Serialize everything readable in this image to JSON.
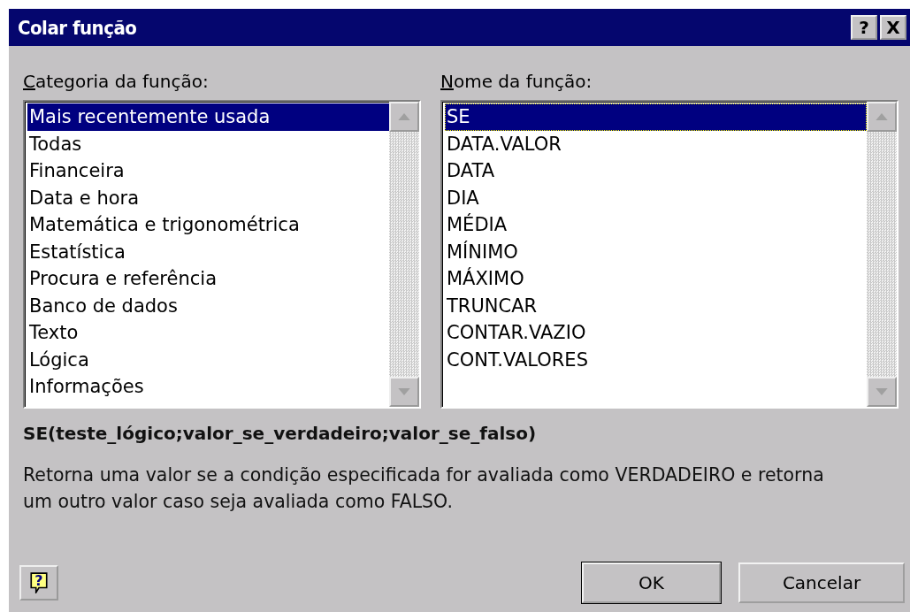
{
  "window": {
    "title": "Colar função",
    "title_buttons": [
      "?",
      "X"
    ]
  },
  "help_button": "?",
  "lists": [
    {
      "label": "Categoria da função:",
      "focused": false,
      "items": [
        {
          "text": "Mais recentemente usada",
          "selected": true
        },
        {
          "text": "Todas",
          "selected": false
        },
        {
          "text": "Financeira",
          "selected": false
        },
        {
          "text": "Data e hora",
          "selected": false
        },
        {
          "text": "Matemática e trigonométrica",
          "selected": false
        },
        {
          "text": "Estatística",
          "selected": false
        },
        {
          "text": "Procura e referência",
          "selected": false
        },
        {
          "text": "Banco de dados",
          "selected": false
        },
        {
          "text": "Texto",
          "selected": false
        },
        {
          "text": "Lógica",
          "selected": false
        },
        {
          "text": "Informações",
          "selected": false
        }
      ]
    },
    {
      "label": "Nome da função:",
      "focused": true,
      "items": [
        {
          "text": "SE",
          "selected": true
        },
        {
          "text": "DATA.VALOR",
          "selected": false
        },
        {
          "text": "DATA",
          "selected": false
        },
        {
          "text": "DIA",
          "selected": false
        },
        {
          "text": "MÉDIA",
          "selected": false
        },
        {
          "text": "MÍNIMO",
          "selected": false
        },
        {
          "text": "MÁXIMO",
          "selected": false
        },
        {
          "text": "TRUNCAR",
          "selected": false
        },
        {
          "text": "CONTAR.VAZIO",
          "selected": false
        },
        {
          "text": "CONT.VALORES",
          "selected": false
        }
      ]
    }
  ],
  "signature": "SE(teste_lógico;valor_se_verdadeiro;valor_se_falso)",
  "description": "Retorna uma valor se a condição especificada for avaliada como VERDADEIRO e retorna um outro valor caso seja avaliada como FALSO.",
  "buttons": [
    {
      "label": "OK",
      "default": true
    },
    {
      "label": "Cancelar",
      "default": false
    }
  ]
}
